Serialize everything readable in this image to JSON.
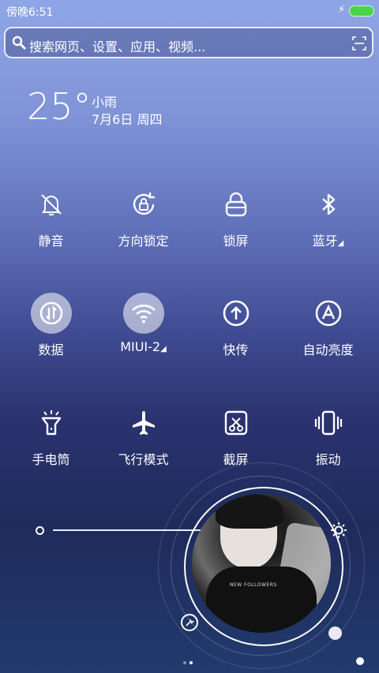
{
  "status_bar": {
    "time": "傍晚6:51",
    "charging_icon": "bolt-icon"
  },
  "search": {
    "placeholder": "搜索网页、设置、应用、视频..."
  },
  "weather": {
    "temperature": "25°",
    "condition": "小雨",
    "date": "7月6日 周四"
  },
  "tiles": [
    {
      "label": "静音",
      "icon": "bell-off-icon",
      "active": false
    },
    {
      "label": "方向锁定",
      "icon": "rotation-lock-icon",
      "active": false
    },
    {
      "label": "锁屏",
      "icon": "lock-icon",
      "active": false
    },
    {
      "label": "蓝牙",
      "icon": "bluetooth-icon",
      "active": false,
      "dropdown": true
    },
    {
      "label": "数据",
      "icon": "mobile-data-icon",
      "active": true
    },
    {
      "label": "MIUI-2",
      "icon": "wifi-icon",
      "active": true,
      "dropdown": true
    },
    {
      "label": "快传",
      "icon": "quick-share-icon",
      "active": false
    },
    {
      "label": "自动亮度",
      "icon": "auto-brightness-icon",
      "active": false
    },
    {
      "label": "手电筒",
      "icon": "flashlight-icon",
      "active": false
    },
    {
      "label": "飞行模式",
      "icon": "airplane-icon",
      "active": false
    },
    {
      "label": "截屏",
      "icon": "screenshot-icon",
      "active": false
    },
    {
      "label": "振动",
      "icon": "vibrate-icon",
      "active": false
    }
  ],
  "brightness": {
    "level_fraction": 0.72
  },
  "music_widget": {
    "shirt_text": "NEW FOLLOWERS",
    "settings_icon": "wrench-icon"
  },
  "pager": {
    "pages": 2,
    "current": 2
  },
  "colors": {
    "battery": "#49d54a",
    "active_tile_bg": "rgba(255,255,255,0.55)"
  }
}
